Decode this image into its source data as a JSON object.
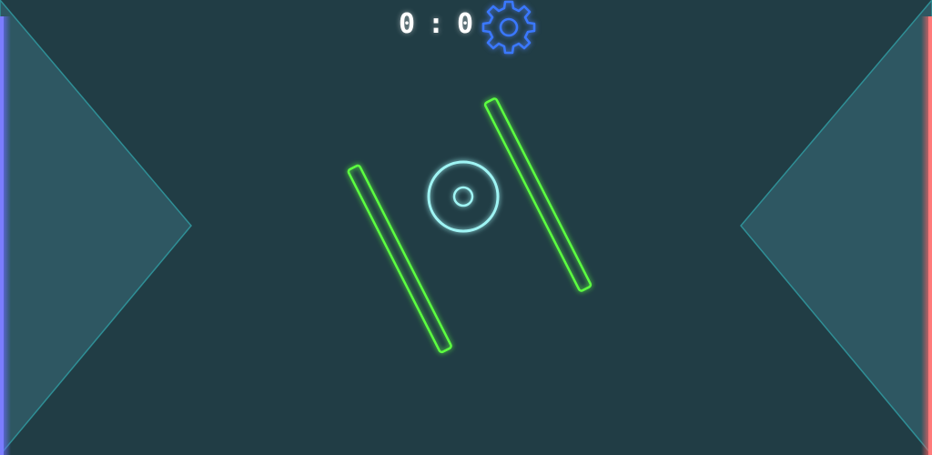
{
  "game": {
    "score": {
      "left": "0",
      "separator": ":",
      "right": "0"
    },
    "settings_icon": "gear-icon",
    "colors": {
      "background": "#213d45",
      "goal_zone": "#2e5762",
      "goal_zone_edge": "#2f8f96",
      "left_goal_line": "#6a6cff",
      "right_goal_line": "#ff6666",
      "barrier": "#5cff40",
      "puck": "#9ff4f4",
      "gear": "#3a78ff",
      "score_text": "#ffffff"
    }
  }
}
